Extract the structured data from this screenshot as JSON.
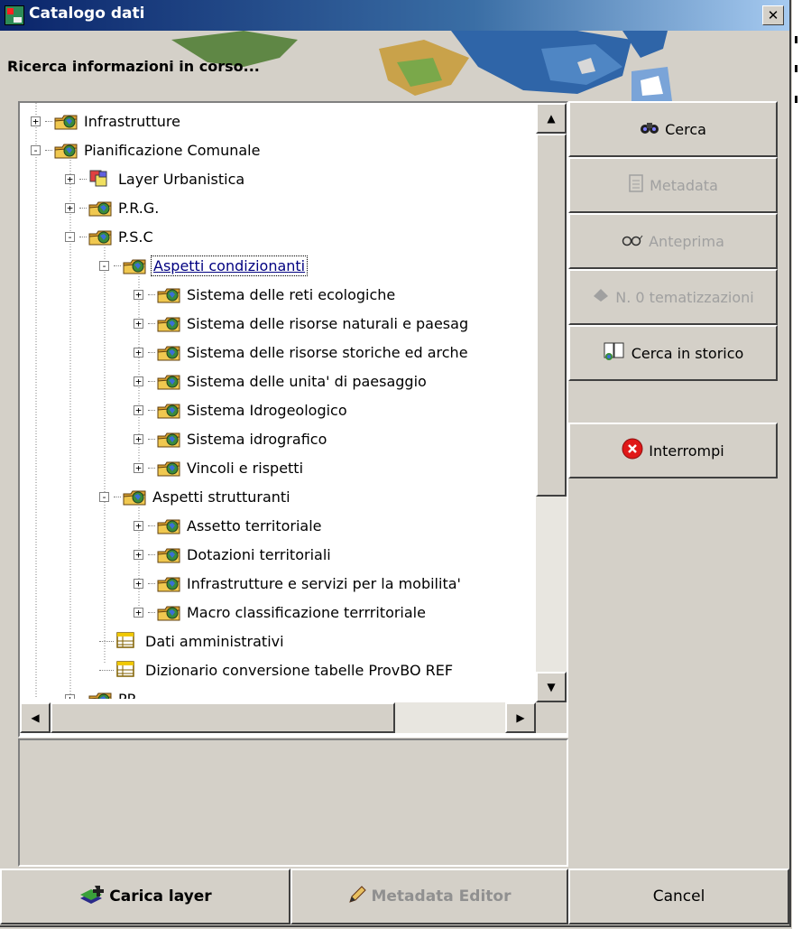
{
  "window": {
    "title": "Catalogo dati",
    "close_label": "✕"
  },
  "banner": {
    "status": "Ricerca informazioni in corso..."
  },
  "tree": {
    "rows": [
      {
        "label": "Infrastrutture",
        "expander": "+",
        "icon": "folder-globe-icon"
      },
      {
        "label": "Pianificazione Comunale",
        "expander": "−",
        "icon": "folder-globe-icon"
      },
      {
        "label": "Layer Urbanistica",
        "expander": "+",
        "icon": "layer-group-icon"
      },
      {
        "label": "P.R.G.",
        "expander": "+",
        "icon": "folder-globe-icon"
      },
      {
        "label": "P.S.C",
        "expander": "−",
        "icon": "folder-globe-icon"
      },
      {
        "label": "Aspetti condizionanti",
        "expander": "−",
        "icon": "folder-globe-icon",
        "selected": true
      },
      {
        "label": "Sistema delle reti ecologiche",
        "expander": "+",
        "icon": "folder-globe-icon"
      },
      {
        "label": "Sistema delle risorse naturali e paesag",
        "expander": "+",
        "icon": "folder-globe-icon"
      },
      {
        "label": "Sistema delle risorse storiche ed arche",
        "expander": "+",
        "icon": "folder-globe-icon"
      },
      {
        "label": "Sistema delle unita' di paesaggio",
        "expander": "+",
        "icon": "folder-globe-icon"
      },
      {
        "label": "Sistema Idrogeologico",
        "expander": "+",
        "icon": "folder-globe-icon"
      },
      {
        "label": "Sistema idrografico",
        "expander": "+",
        "icon": "folder-globe-icon"
      },
      {
        "label": "Vincoli e rispetti",
        "expander": "+",
        "icon": "folder-globe-icon"
      },
      {
        "label": "Aspetti strutturanti",
        "expander": "−",
        "icon": "folder-globe-icon"
      },
      {
        "label": "Assetto territoriale",
        "expander": "+",
        "icon": "folder-globe-icon"
      },
      {
        "label": "Dotazioni territoriali",
        "expander": "+",
        "icon": "folder-globe-icon"
      },
      {
        "label": "Infrastrutture e servizi per la mobilita'",
        "expander": "+",
        "icon": "folder-globe-icon"
      },
      {
        "label": "Macro classificazione terrritoriale",
        "expander": "+",
        "icon": "folder-globe-icon"
      },
      {
        "label": "Dati amministrativi",
        "expander": "",
        "icon": "table-icon"
      },
      {
        "label": "Dizionario conversione tabelle ProvBO REF",
        "expander": "",
        "icon": "table-icon"
      },
      {
        "label": "PP",
        "expander": "+",
        "icon": "folder-globe-icon"
      }
    ]
  },
  "buttons": {
    "cerca": "Cerca",
    "metadata": "Metadata",
    "anteprima": "Anteprima",
    "tematizzazioni": "N. 0 tematizzazioni",
    "cerca_storico": "Cerca in storico",
    "interrompi": "Interrompi",
    "carica_layer": "Carica layer",
    "metadata_editor": "Metadata Editor",
    "cancel": "Cancel"
  },
  "colors": {
    "titlebar_start": "#0a246a",
    "titlebar_end": "#a6caf0",
    "face": "#d4d0c8",
    "selected_text": "#000080",
    "disabled_text": "#a0a0a0",
    "stop_red": "#e01818"
  }
}
